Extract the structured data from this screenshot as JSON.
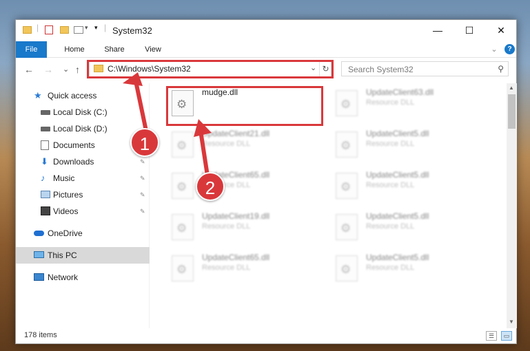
{
  "window": {
    "title": "System32",
    "min_glyph": "—",
    "max_glyph": "☐",
    "close_glyph": "✕"
  },
  "ribbon": {
    "tabs": [
      "File",
      "Home",
      "Share",
      "View"
    ],
    "expand_glyph": "⌄",
    "help_glyph": "?"
  },
  "nav": {
    "back_glyph": "←",
    "forward_glyph": "→",
    "recent_glyph": "⌄",
    "up_glyph": "↑",
    "address": "C:\\Windows\\System32",
    "address_drop_glyph": "⌄",
    "refresh_glyph": "↻",
    "search_placeholder": "Search System32",
    "search_glyph": "⚲"
  },
  "sidebar": {
    "items": [
      {
        "label": "Quick access",
        "icon": "star-icon"
      },
      {
        "label": "Local Disk (C:)",
        "icon": "drive-icon"
      },
      {
        "label": "Local Disk (D:)",
        "icon": "drive-icon"
      },
      {
        "label": "Documents",
        "icon": "documents-icon"
      },
      {
        "label": "Downloads",
        "icon": "download-icon"
      },
      {
        "label": "Music",
        "icon": "music-icon"
      },
      {
        "label": "Pictures",
        "icon": "pictures-icon"
      },
      {
        "label": "Videos",
        "icon": "videos-icon"
      },
      {
        "label": "OneDrive",
        "icon": "cloud-icon"
      },
      {
        "label": "This PC",
        "icon": "computer-icon"
      },
      {
        "label": "Network",
        "icon": "network-icon"
      }
    ],
    "pin_glyph": "📌"
  },
  "files": {
    "highlighted": {
      "name": "mudge.dll"
    },
    "items": [
      {
        "name": "UpdateClient63.dll",
        "type": "Resource DLL"
      },
      {
        "name": "UpdateClient21.dll",
        "type": "Resource DLL"
      },
      {
        "name": "UpdateClient5.dll",
        "type": "Resource DLL"
      },
      {
        "name": "UpdateClient65.dll",
        "type": "Resource DLL"
      },
      {
        "name": "UpdateClient5.dll",
        "type": "Resource DLL"
      },
      {
        "name": "UpdateClient19.dll",
        "type": "Resource DLL"
      },
      {
        "name": "UpdateClient5.dll",
        "type": "Resource DLL"
      },
      {
        "name": "UpdateClient65.dll",
        "type": "Resource DLL"
      },
      {
        "name": "UpdateClient5.dll",
        "type": "Resource DLL"
      }
    ]
  },
  "status": {
    "count": "178 items"
  },
  "annotations": {
    "badge1": "1",
    "badge2": "2",
    "color": "#d9383b"
  }
}
